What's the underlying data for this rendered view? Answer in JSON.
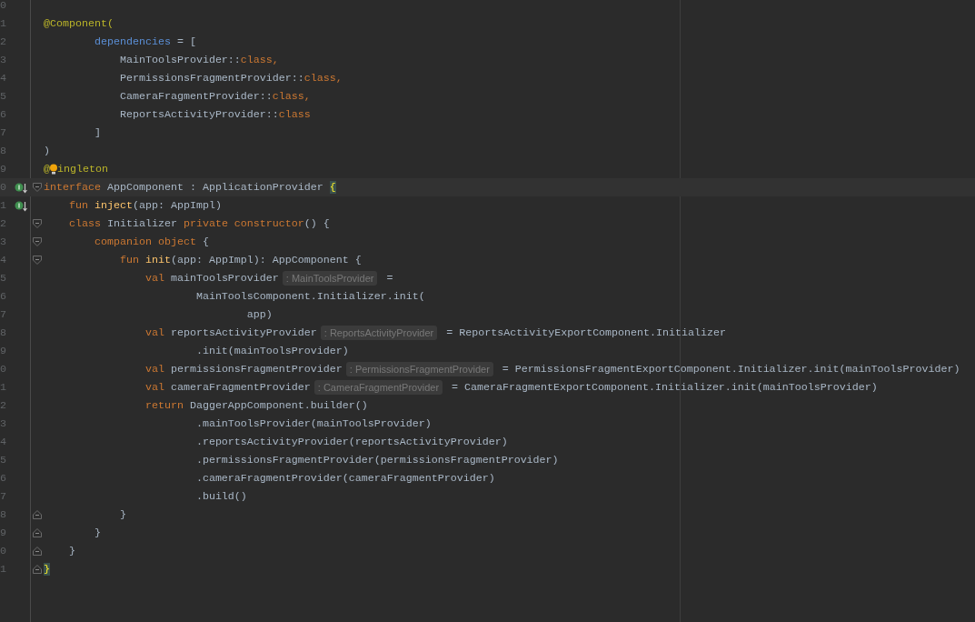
{
  "editor": {
    "lines": [
      {
        "number": "0"
      },
      {
        "number": "1",
        "segments": [
          {
            "kind": "code",
            "tokens": [
              {
                "kind": "annotation",
                "text": "@Component("
              }
            ]
          }
        ]
      },
      {
        "number": "2",
        "segments": [
          {
            "kind": "code",
            "tokens": [
              {
                "kind": "named-arg",
                "text": "        dependencies"
              },
              {
                "kind": "plain",
                "text": " = ["
              }
            ]
          }
        ]
      },
      {
        "number": "3",
        "segments": [
          {
            "kind": "code",
            "tokens": [
              {
                "kind": "plain",
                "text": "            MainToolsProvider::"
              },
              {
                "kind": "keyword",
                "text": "class,"
              }
            ]
          }
        ]
      },
      {
        "number": "4",
        "segments": [
          {
            "kind": "code",
            "tokens": [
              {
                "kind": "plain",
                "text": "            PermissionsFragmentProvider::"
              },
              {
                "kind": "keyword",
                "text": "class,"
              }
            ]
          }
        ]
      },
      {
        "number": "5",
        "segments": [
          {
            "kind": "code",
            "tokens": [
              {
                "kind": "plain",
                "text": "            CameraFragmentProvider::"
              },
              {
                "kind": "keyword",
                "text": "class,"
              }
            ]
          }
        ]
      },
      {
        "number": "6",
        "segments": [
          {
            "kind": "code",
            "tokens": [
              {
                "kind": "plain",
                "text": "            ReportsActivityProvider::"
              },
              {
                "kind": "keyword",
                "text": "class"
              }
            ]
          }
        ]
      },
      {
        "number": "7",
        "segments": [
          {
            "kind": "code",
            "tokens": [
              {
                "kind": "plain",
                "text": "        ]"
              }
            ]
          }
        ]
      },
      {
        "number": "8",
        "segments": [
          {
            "kind": "code",
            "tokens": [
              {
                "kind": "plain",
                "text": ")"
              }
            ]
          }
        ]
      },
      {
        "number": "9",
        "segments": [
          {
            "kind": "code",
            "tokens": [
              {
                "kind": "annotation",
                "text": "@"
              }
            ]
          },
          {
            "kind": "intention"
          },
          {
            "kind": "code",
            "tokens": [
              {
                "kind": "annotation",
                "text": "ingleton"
              }
            ]
          }
        ]
      },
      {
        "number": "0",
        "gutter": {
          "kind": "implemented"
        },
        "fold": {
          "kind": "start"
        },
        "current": true,
        "segments": [
          {
            "kind": "code",
            "tokens": [
              {
                "kind": "keyword",
                "text": "interface"
              },
              {
                "kind": "plain",
                "text": " AppComponent : ApplicationProvider "
              },
              {
                "kind": "brace-match",
                "text": "{"
              }
            ]
          }
        ]
      },
      {
        "number": "1",
        "gutter": {
          "kind": "implemented"
        },
        "segments": [
          {
            "kind": "code",
            "tokens": [
              {
                "kind": "keyword",
                "text": "    fun "
              },
              {
                "kind": "function",
                "text": "inject"
              },
              {
                "kind": "plain",
                "text": "(app: AppImpl)"
              }
            ]
          }
        ]
      },
      {
        "number": "2",
        "fold": {
          "kind": "start"
        },
        "segments": [
          {
            "kind": "code",
            "tokens": [
              {
                "kind": "keyword",
                "text": "    class"
              },
              {
                "kind": "plain",
                "text": " Initializer "
              },
              {
                "kind": "keyword",
                "text": "private constructor"
              },
              {
                "kind": "plain",
                "text": "() {"
              }
            ]
          }
        ]
      },
      {
        "number": "3",
        "fold": {
          "kind": "start"
        },
        "segments": [
          {
            "kind": "code",
            "tokens": [
              {
                "kind": "keyword",
                "text": "        companion object"
              },
              {
                "kind": "plain",
                "text": " {"
              }
            ]
          }
        ]
      },
      {
        "number": "4",
        "fold": {
          "kind": "start"
        },
        "segments": [
          {
            "kind": "code",
            "tokens": [
              {
                "kind": "keyword",
                "text": "            fun "
              },
              {
                "kind": "function",
                "text": "init"
              },
              {
                "kind": "plain",
                "text": "(app: AppImpl): AppComponent {"
              }
            ]
          }
        ]
      },
      {
        "number": "5",
        "segments": [
          {
            "kind": "code",
            "tokens": [
              {
                "kind": "keyword",
                "text": "                val"
              },
              {
                "kind": "plain",
                "text": " mainToolsProvider"
              }
            ]
          },
          {
            "kind": "hint",
            "text": ": MainToolsProvider"
          },
          {
            "kind": "code",
            "tokens": [
              {
                "kind": "plain",
                "text": " ="
              }
            ]
          }
        ]
      },
      {
        "number": "6",
        "segments": [
          {
            "kind": "code",
            "tokens": [
              {
                "kind": "plain",
                "text": "                        MainToolsComponent.Initializer.init("
              }
            ]
          }
        ]
      },
      {
        "number": "7",
        "segments": [
          {
            "kind": "code",
            "tokens": [
              {
                "kind": "plain",
                "text": "                                app)"
              }
            ]
          }
        ]
      },
      {
        "number": "8",
        "segments": [
          {
            "kind": "code",
            "tokens": [
              {
                "kind": "keyword",
                "text": "                val"
              },
              {
                "kind": "plain",
                "text": " reportsActivityProvider"
              }
            ]
          },
          {
            "kind": "hint",
            "text": ": ReportsActivityProvider"
          },
          {
            "kind": "code",
            "tokens": [
              {
                "kind": "plain",
                "text": " = ReportsActivityExportComponent.Initializer"
              }
            ]
          }
        ]
      },
      {
        "number": "9",
        "segments": [
          {
            "kind": "code",
            "tokens": [
              {
                "kind": "plain",
                "text": "                        .init(mainToolsProvider)"
              }
            ]
          }
        ]
      },
      {
        "number": "0",
        "segments": [
          {
            "kind": "code",
            "tokens": [
              {
                "kind": "keyword",
                "text": "                val"
              },
              {
                "kind": "plain",
                "text": " permissionsFragmentProvider"
              }
            ]
          },
          {
            "kind": "hint",
            "text": ": PermissionsFragmentProvider"
          },
          {
            "kind": "code",
            "tokens": [
              {
                "kind": "plain",
                "text": " = PermissionsFragmentExportComponent.Initializer.init(mainToolsProvider)"
              }
            ]
          }
        ]
      },
      {
        "number": "1",
        "segments": [
          {
            "kind": "code",
            "tokens": [
              {
                "kind": "keyword",
                "text": "                val"
              },
              {
                "kind": "plain",
                "text": " cameraFragmentProvider"
              }
            ]
          },
          {
            "kind": "hint",
            "text": ": CameraFragmentProvider"
          },
          {
            "kind": "code",
            "tokens": [
              {
                "kind": "plain",
                "text": " = CameraFragmentExportComponent.Initializer.init(mainToolsProvider)"
              }
            ]
          }
        ]
      },
      {
        "number": "2",
        "segments": [
          {
            "kind": "code",
            "tokens": [
              {
                "kind": "keyword",
                "text": "                return"
              },
              {
                "kind": "plain",
                "text": " DaggerAppComponent.builder()"
              }
            ]
          }
        ]
      },
      {
        "number": "3",
        "segments": [
          {
            "kind": "code",
            "tokens": [
              {
                "kind": "plain",
                "text": "                        .mainToolsProvider(mainToolsProvider)"
              }
            ]
          }
        ]
      },
      {
        "number": "4",
        "segments": [
          {
            "kind": "code",
            "tokens": [
              {
                "kind": "plain",
                "text": "                        .reportsActivityProvider(reportsActivityProvider)"
              }
            ]
          }
        ]
      },
      {
        "number": "5",
        "segments": [
          {
            "kind": "code",
            "tokens": [
              {
                "kind": "plain",
                "text": "                        .permissionsFragmentProvider(permissionsFragmentProvider)"
              }
            ]
          }
        ]
      },
      {
        "number": "6",
        "segments": [
          {
            "kind": "code",
            "tokens": [
              {
                "kind": "plain",
                "text": "                        .cameraFragmentProvider(cameraFragmentProvider)"
              }
            ]
          }
        ]
      },
      {
        "number": "7",
        "segments": [
          {
            "kind": "code",
            "tokens": [
              {
                "kind": "plain",
                "text": "                        .build()"
              }
            ]
          }
        ]
      },
      {
        "number": "8",
        "fold": {
          "kind": "end"
        },
        "segments": [
          {
            "kind": "code",
            "tokens": [
              {
                "kind": "plain",
                "text": "            }"
              }
            ]
          }
        ]
      },
      {
        "number": "9",
        "fold": {
          "kind": "end"
        },
        "segments": [
          {
            "kind": "code",
            "tokens": [
              {
                "kind": "plain",
                "text": "        }"
              }
            ]
          }
        ]
      },
      {
        "number": "0",
        "fold": {
          "kind": "end"
        },
        "segments": [
          {
            "kind": "code",
            "tokens": [
              {
                "kind": "plain",
                "text": "    }"
              }
            ]
          }
        ]
      },
      {
        "number": "1",
        "fold": {
          "kind": "end"
        },
        "segments": [
          {
            "kind": "code",
            "tokens": [
              {
                "kind": "brace-match",
                "text": "}"
              }
            ]
          }
        ]
      }
    ]
  }
}
